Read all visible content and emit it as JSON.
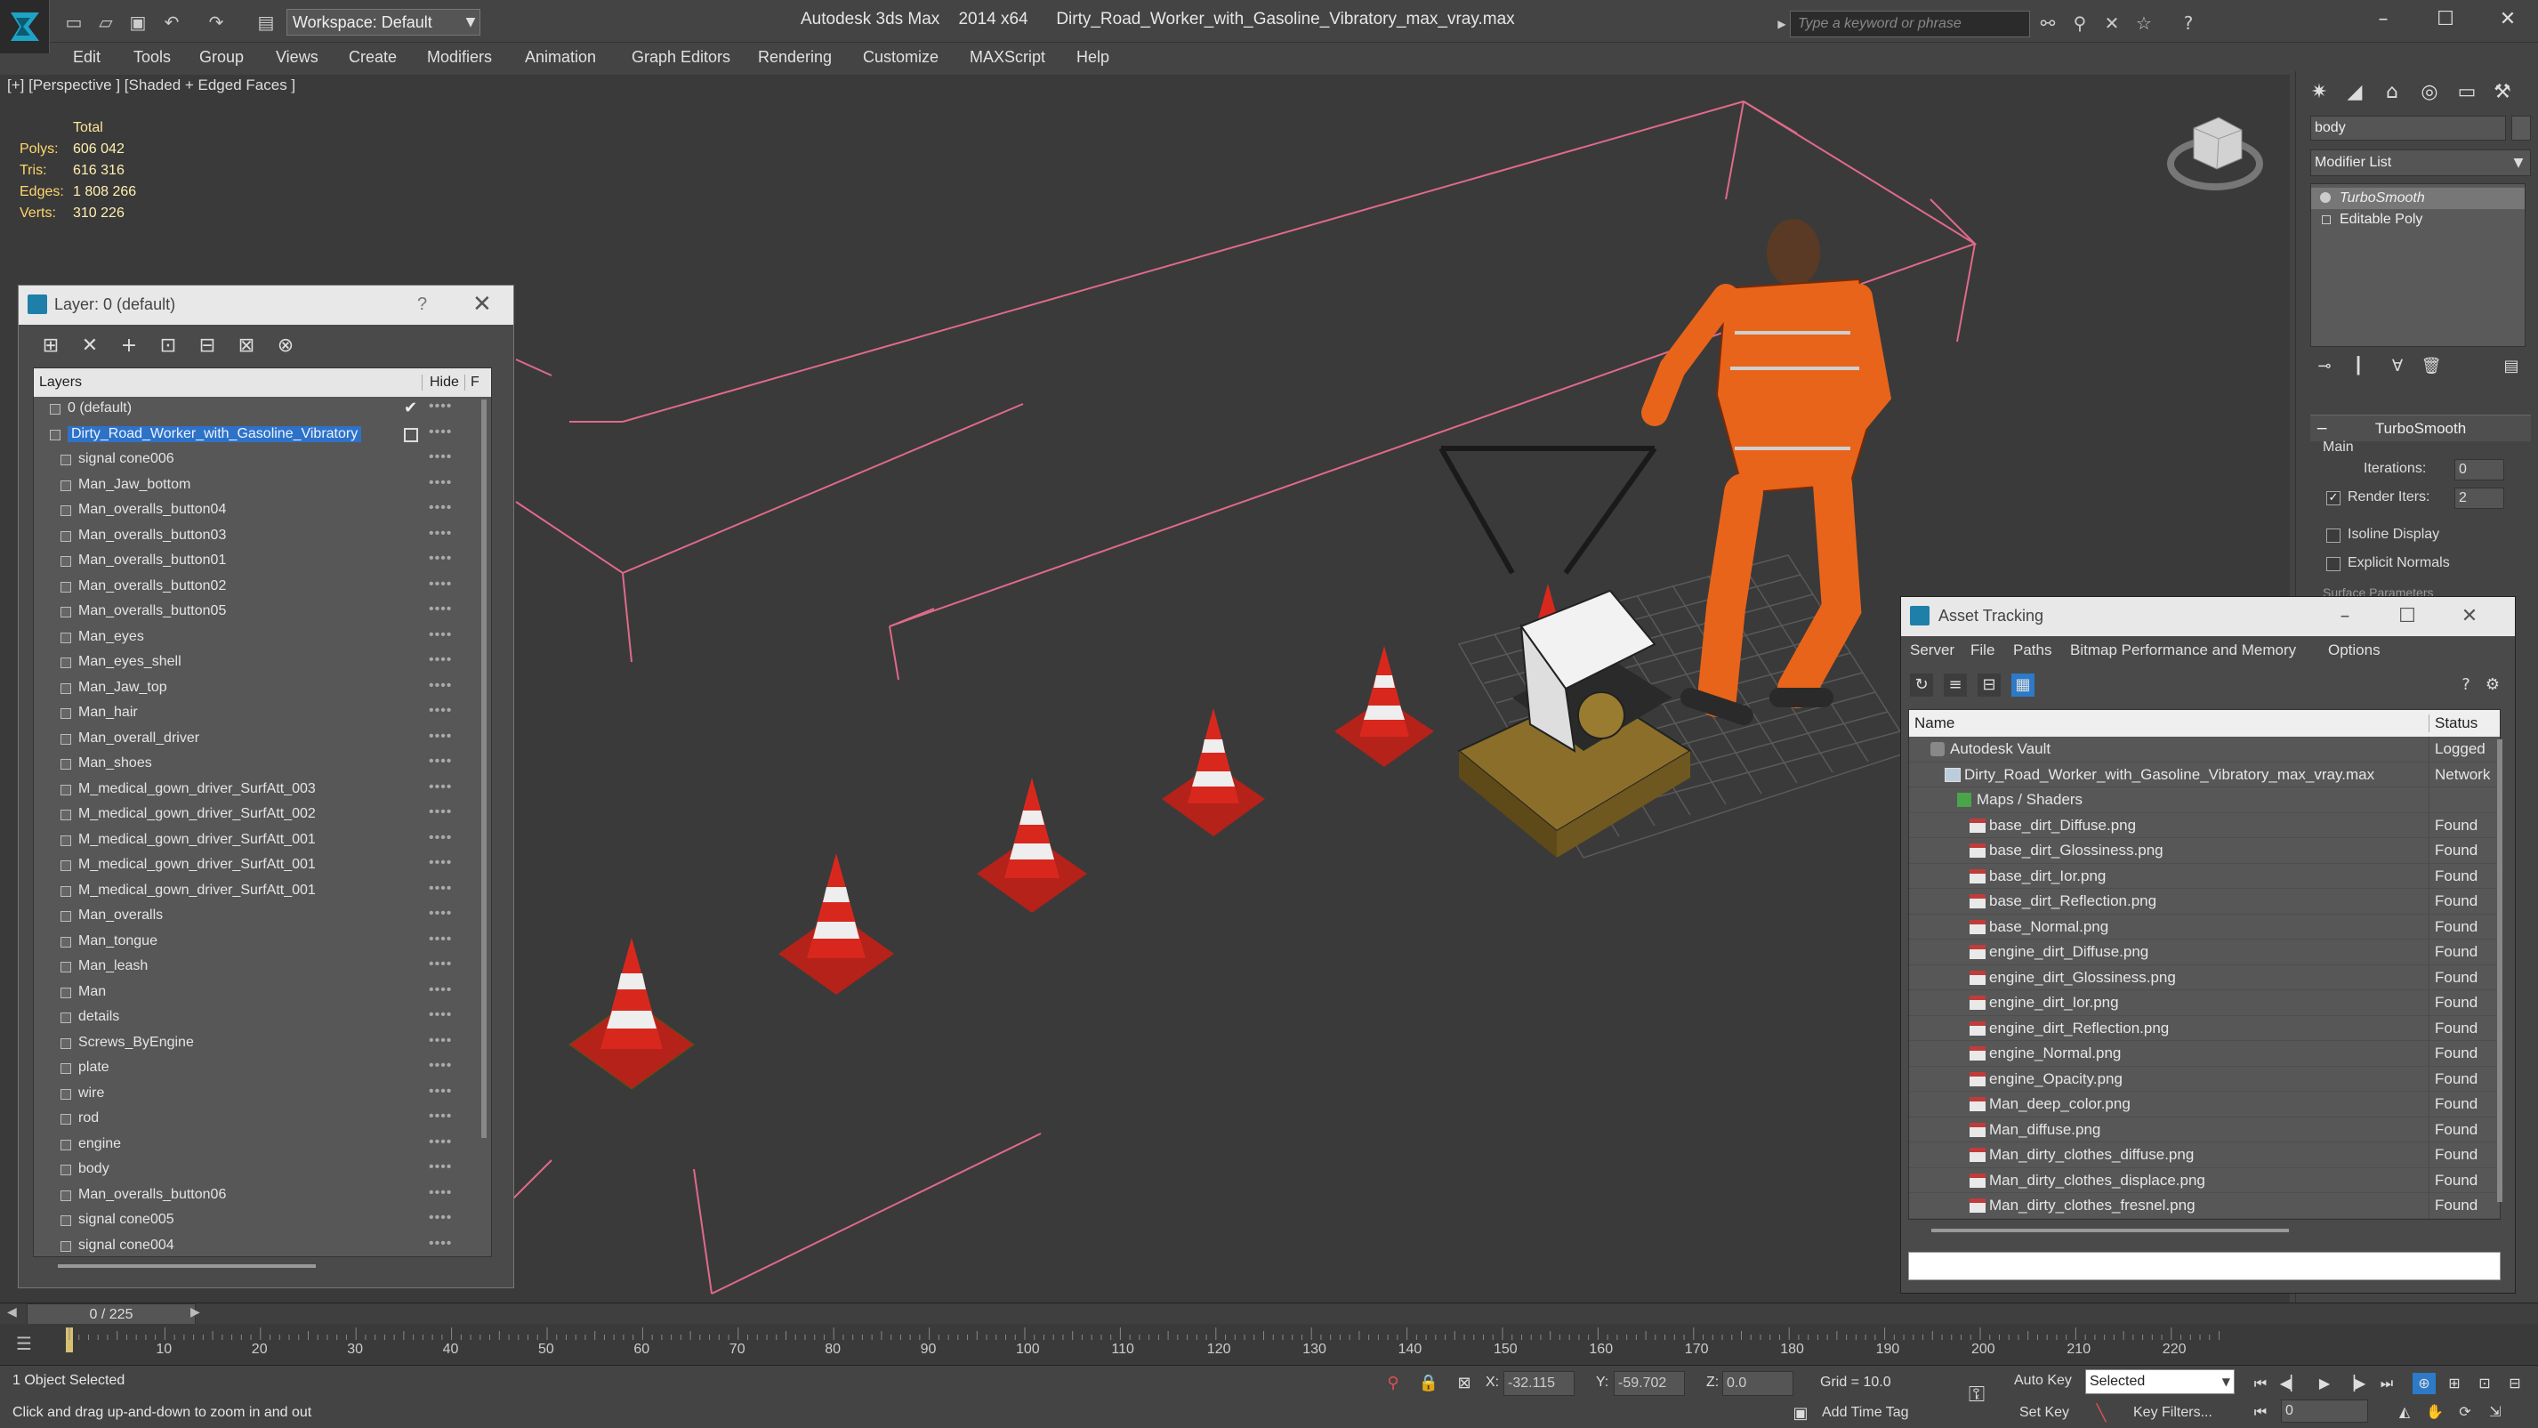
{
  "titlebar": {
    "workspace": "Workspace: Default",
    "app": "Autodesk 3ds Max",
    "version": "2014 x64",
    "file": "Dirty_Road_Worker_with_Gasoline_Vibratory_max_vray.max",
    "search_placeholder": "Type a keyword or phrase"
  },
  "menu": [
    "Edit",
    "Tools",
    "Group",
    "Views",
    "Create",
    "Modifiers",
    "Animation",
    "Graph Editors",
    "Rendering",
    "Customize",
    "MAXScript",
    "Help"
  ],
  "viewport": {
    "label": "[+] [Perspective ] [Shaded + Edged Faces ]",
    "stats": {
      "total_label": "Total",
      "polys_label": "Polys:",
      "polys": "606 042",
      "tris_label": "Tris:",
      "tris": "616 316",
      "edges_label": "Edges:",
      "edges": "1 808 266",
      "verts_label": "Verts:",
      "verts": "310 226"
    }
  },
  "layer_dialog": {
    "title": "Layer: 0 (default)",
    "help": "?",
    "header_layers": "Layers",
    "header_hide": "Hide",
    "header_f": "F",
    "rows": [
      "0 (default)",
      "Dirty_Road_Worker_with_Gasoline_Vibratory",
      "signal cone006",
      "Man_Jaw_bottom",
      "Man_overalls_button04",
      "Man_overalls_button03",
      "Man_overalls_button01",
      "Man_overalls_button02",
      "Man_overalls_button05",
      "Man_eyes",
      "Man_eyes_shell",
      "Man_Jaw_top",
      "Man_hair",
      "Man_overall_driver",
      "Man_shoes",
      "M_medical_gown_driver_SurfAtt_003",
      "M_medical_gown_driver_SurfAtt_002",
      "M_medical_gown_driver_SurfAtt_001",
      "M_medical_gown_driver_SurfAtt_001",
      "M_medical_gown_driver_SurfAtt_001",
      "Man_overalls",
      "Man_tongue",
      "Man_leash",
      "Man",
      "details",
      "Screws_ByEngine",
      "plate",
      "wire",
      "rod",
      "engine",
      "body",
      "Man_overalls_button06",
      "signal cone005",
      "signal cone004"
    ],
    "row_dots": "••••"
  },
  "command_panel": {
    "object_name": "body",
    "modifier_list": "Modifier List",
    "stack": [
      "TurboSmooth",
      "Editable Poly"
    ],
    "rollout_title": "TurboSmooth",
    "main_label": "Main",
    "iterations_label": "Iterations:",
    "iterations": "0",
    "render_iters_label": "Render Iters:",
    "render_iters": "2",
    "isoline_label": "Isoline Display",
    "explicit_label": "Explicit Normals",
    "surface_label": "Surface Parameters"
  },
  "asset_dialog": {
    "title": "Asset Tracking",
    "menu": [
      "Server",
      "File",
      "Paths",
      "Bitmap Performance and Memory",
      "Options"
    ],
    "col_name": "Name",
    "col_status": "Status",
    "rows": [
      {
        "name": "Autodesk Vault",
        "status": "Logged",
        "level": 0,
        "icon": "vault"
      },
      {
        "name": "Dirty_Road_Worker_with_Gasoline_Vibratory_max_vray.max",
        "status": "Network",
        "level": 1,
        "icon": "doc"
      },
      {
        "name": "Maps / Shaders",
        "status": "",
        "level": 2,
        "icon": "maps"
      },
      {
        "name": "base_dirt_Diffuse.png",
        "status": "Found",
        "level": 3,
        "icon": "file"
      },
      {
        "name": "base_dirt_Glossiness.png",
        "status": "Found",
        "level": 3,
        "icon": "file"
      },
      {
        "name": "base_dirt_Ior.png",
        "status": "Found",
        "level": 3,
        "icon": "file"
      },
      {
        "name": "base_dirt_Reflection.png",
        "status": "Found",
        "level": 3,
        "icon": "file"
      },
      {
        "name": "base_Normal.png",
        "status": "Found",
        "level": 3,
        "icon": "file"
      },
      {
        "name": "engine_dirt_Diffuse.png",
        "status": "Found",
        "level": 3,
        "icon": "file"
      },
      {
        "name": "engine_dirt_Glossiness.png",
        "status": "Found",
        "level": 3,
        "icon": "file"
      },
      {
        "name": "engine_dirt_Ior.png",
        "status": "Found",
        "level": 3,
        "icon": "file"
      },
      {
        "name": "engine_dirt_Reflection.png",
        "status": "Found",
        "level": 3,
        "icon": "file"
      },
      {
        "name": "engine_Normal.png",
        "status": "Found",
        "level": 3,
        "icon": "file"
      },
      {
        "name": "engine_Opacity.png",
        "status": "Found",
        "level": 3,
        "icon": "file"
      },
      {
        "name": "Man_deep_color.png",
        "status": "Found",
        "level": 3,
        "icon": "file"
      },
      {
        "name": "Man_diffuse.png",
        "status": "Found",
        "level": 3,
        "icon": "file"
      },
      {
        "name": "Man_dirty_clothes_diffuse.png",
        "status": "Found",
        "level": 3,
        "icon": "file"
      },
      {
        "name": "Man_dirty_clothes_displace.png",
        "status": "Found",
        "level": 3,
        "icon": "file"
      },
      {
        "name": "Man_dirty_clothes_fresnel.png",
        "status": "Found",
        "level": 3,
        "icon": "file"
      }
    ]
  },
  "timeline": {
    "frame_display": "0 / 225",
    "ticks": [
      "10",
      "20",
      "30",
      "40",
      "50",
      "60",
      "70",
      "80",
      "90",
      "100",
      "110",
      "120",
      "130",
      "140",
      "150",
      "160",
      "170",
      "180",
      "190",
      "200",
      "210",
      "220"
    ]
  },
  "status": {
    "selection": "1 Object Selected",
    "prompt": "Click and drag up-and-down to zoom in and out",
    "x_label": "X:",
    "x": "-32.115",
    "y_label": "Y:",
    "y": "-59.702",
    "z_label": "Z:",
    "z": "0.0",
    "grid": "Grid = 10.0",
    "add_time_tag": "Add Time Tag",
    "auto_key": "Auto Key",
    "set_key": "Set Key",
    "selected": "Selected",
    "key_filters": "Key Filters...",
    "frame": "0"
  },
  "colors": {
    "selection_blue": "#2e72c8",
    "stats_yellow": "#ffe39a",
    "worker_orange": "#e8641a",
    "cone_red": "#d8281e",
    "bbox_pink": "#e06a8a"
  }
}
